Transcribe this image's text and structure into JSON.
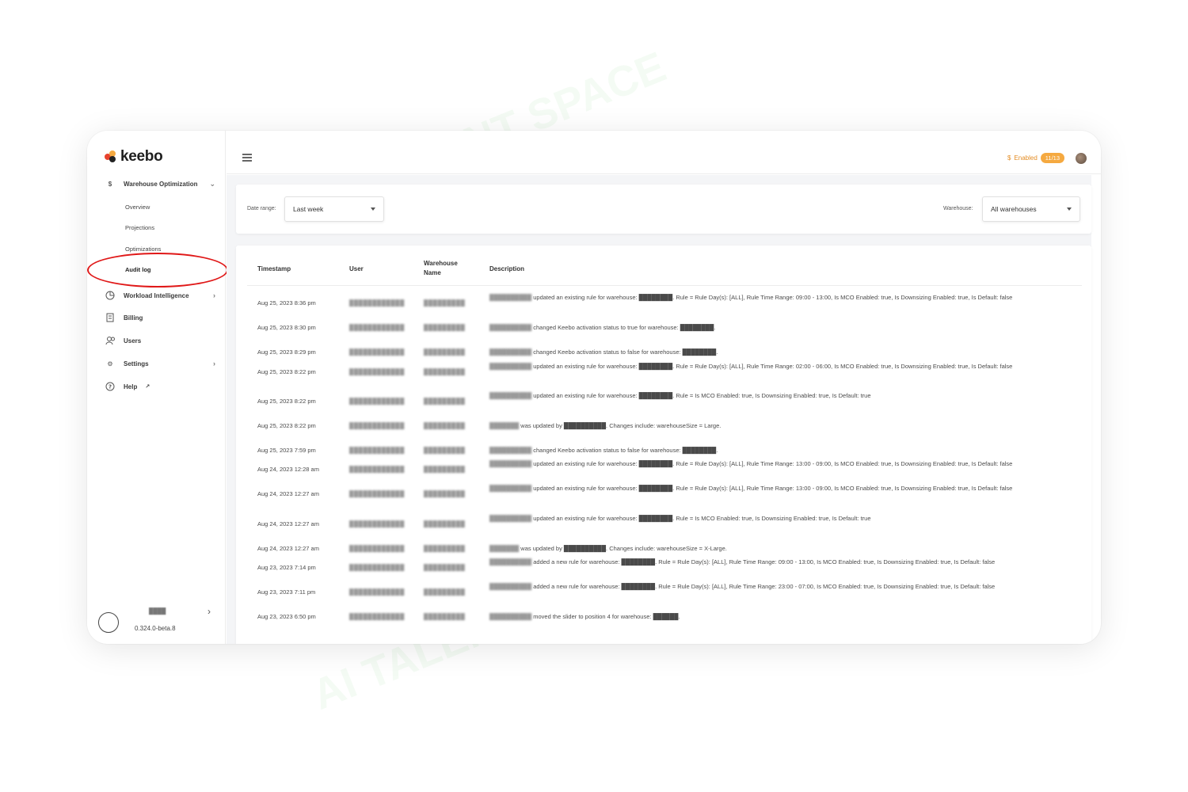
{
  "brand": {
    "name": "keebo"
  },
  "sidebar": {
    "sections": [
      {
        "label": "Warehouse Optimization",
        "icon": "dollar-icon",
        "expanded": true,
        "children": [
          {
            "label": "Overview"
          },
          {
            "label": "Projections"
          },
          {
            "label": "Optimizations"
          },
          {
            "label": "Audit log",
            "active": true
          }
        ]
      },
      {
        "label": "Workload Intelligence",
        "icon": "pie-chart-icon",
        "has_submenu": true
      },
      {
        "label": "Billing",
        "icon": "invoice-icon"
      },
      {
        "label": "Users",
        "icon": "users-icon"
      },
      {
        "label": "Settings",
        "icon": "gear-icon",
        "has_submenu": true
      },
      {
        "label": "Help",
        "icon": "help-icon"
      }
    ],
    "footer": {
      "name": "████",
      "version": "0.324.0-beta.8"
    }
  },
  "topbar": {
    "enabled_label": "Enabled",
    "enabled_count": "11/13"
  },
  "filters": {
    "date_range_label": "Date range:",
    "date_range_value": "Last week",
    "warehouse_label": "Warehouse:",
    "warehouse_value": "All warehouses"
  },
  "table": {
    "columns": [
      "Timestamp",
      "User",
      "Warehouse Name",
      "Description"
    ],
    "rows": [
      {
        "time": "Aug 25, 2023 8:36 pm",
        "user": "████████████",
        "warehouse": "█████████",
        "actor": "██████████",
        "desc": "updated an existing rule for warehouse: ████████. Rule = Rule Day(s): [ALL], Rule Time Range: 09:00 - 13:00, Is MCO Enabled: true, Is Downsizing Enabled: true, Is Default: false"
      },
      {
        "time": "Aug 25, 2023 8:30 pm",
        "user": "████████████",
        "warehouse": "█████████",
        "actor": "██████████",
        "desc": "changed Keebo activation status to true for warehouse: ████████."
      },
      {
        "time": "Aug 25, 2023 8:29 pm",
        "user": "████████████",
        "warehouse": "█████████",
        "actor": "██████████",
        "desc": "changed Keebo activation status to false for warehouse: ████████."
      },
      {
        "time": "Aug 25, 2023 8:22 pm",
        "user": "████████████",
        "warehouse": "█████████",
        "actor": "██████████",
        "desc": "updated an existing rule for warehouse: ████████. Rule = Rule Day(s): [ALL], Rule Time Range: 02:00 - 06:00, Is MCO Enabled: true, Is Downsizing Enabled: true, Is Default: false"
      },
      {
        "time": "Aug 25, 2023 8:22 pm",
        "user": "████████████",
        "warehouse": "█████████",
        "actor": "██████████",
        "desc": "updated an existing rule for warehouse: ████████. Rule = Is MCO Enabled: true, Is Downsizing Enabled: true, Is Default: true"
      },
      {
        "time": "Aug 25, 2023 8:22 pm",
        "user": "████████████",
        "warehouse": "█████████",
        "actor": "███████",
        "desc": "was updated by ██████████. Changes include: warehouseSize = Large."
      },
      {
        "time": "Aug 25, 2023 7:59 pm",
        "user": "████████████",
        "warehouse": "█████████",
        "actor": "██████████",
        "desc": "changed Keebo activation status to false for warehouse: ████████."
      },
      {
        "time": "Aug 24, 2023 12:28 am",
        "user": "████████████",
        "warehouse": "█████████",
        "actor": "██████████",
        "desc": "updated an existing rule for warehouse: ████████. Rule = Rule Day(s): [ALL], Rule Time Range: 13:00 - 09:00, Is MCO Enabled: true, Is Downsizing Enabled: true, Is Default: false"
      },
      {
        "time": "Aug 24, 2023 12:27 am",
        "user": "████████████",
        "warehouse": "█████████",
        "actor": "██████████",
        "desc": "updated an existing rule for warehouse: ████████. Rule = Rule Day(s): [ALL], Rule Time Range: 13:00 - 09:00, Is MCO Enabled: true, Is Downsizing Enabled: true, Is Default: false"
      },
      {
        "time": "Aug 24, 2023 12:27 am",
        "user": "████████████",
        "warehouse": "█████████",
        "actor": "██████████",
        "desc": "updated an existing rule for warehouse: ████████. Rule = Is MCO Enabled: true, Is Downsizing Enabled: true, Is Default: true"
      },
      {
        "time": "Aug 24, 2023 12:27 am",
        "user": "████████████",
        "warehouse": "█████████",
        "actor": "███████",
        "desc": "was updated by ██████████. Changes include: warehouseSize = X-Large."
      },
      {
        "time": "Aug 23, 2023 7:14 pm",
        "user": "████████████",
        "warehouse": "█████████",
        "actor": "██████████",
        "desc": "added a new rule for warehouse: ████████. Rule = Rule Day(s): [ALL], Rule Time Range: 09:00 - 13:00, Is MCO Enabled: true, Is Downsizing Enabled: true, Is Default: false"
      },
      {
        "time": "Aug 23, 2023 7:11 pm",
        "user": "████████████",
        "warehouse": "█████████",
        "actor": "██████████",
        "desc": "added a new rule for warehouse: ████████. Rule = Rule Day(s): [ALL], Rule Time Range: 23:00 - 07:00, Is MCO Enabled: true, Is Downsizing Enabled: true, Is Default: false"
      },
      {
        "time": "Aug 23, 2023 6:50 pm",
        "user": "████████████",
        "warehouse": "█████████",
        "actor": "██████████",
        "desc": "moved the slider to position 4 for warehouse: ██████."
      }
    ]
  },
  "colors": {
    "accent": "#f5a940",
    "highlight": "#e01818",
    "logo_red": "#e8432e",
    "logo_orange": "#f5a940",
    "logo_dark": "#222222"
  },
  "watermark": "AI TALENT SPACE"
}
